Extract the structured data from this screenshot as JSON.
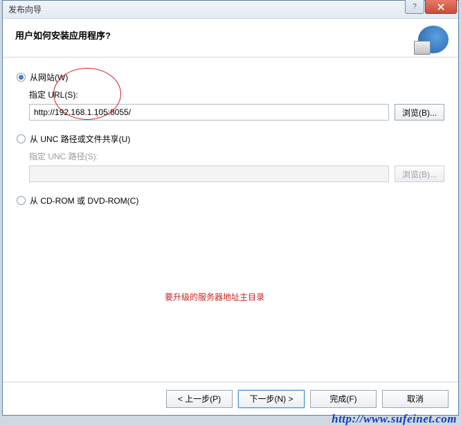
{
  "titlebar": {
    "title": "发布向导"
  },
  "header": {
    "question": "用户如何安装应用程序?"
  },
  "options": {
    "website": {
      "label": "从网站(W)",
      "url_label": "指定 URL(S):",
      "url_value": "http://192.168.1.105:8055/",
      "browse": "浏览(B)..."
    },
    "unc": {
      "label": "从 UNC 路径或文件共享(U)",
      "path_label": "指定 UNC 路径(S):",
      "path_value": "",
      "browse": "浏览(B)..."
    },
    "cdrom": {
      "label": "从 CD-ROM 或 DVD-ROM(C)"
    }
  },
  "annotation": "要升级的服务器地址主目录",
  "footer": {
    "back": "< 上一步(P)",
    "next": "下一步(N) >",
    "finish": "完成(F)",
    "cancel": "取消"
  },
  "watermark": "http://www.sufeinet.com"
}
